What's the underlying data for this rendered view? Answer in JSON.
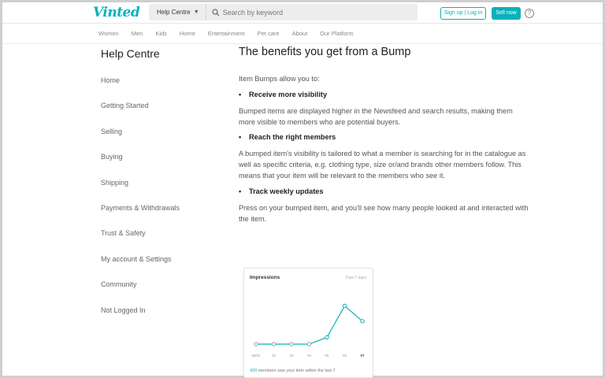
{
  "header": {
    "logo": "Vinted",
    "category_select": "Help Centre",
    "search_placeholder": "Search by keyword",
    "login_label": "Sign up | Log in",
    "sell_label": "Sell now",
    "help_glyph": "?"
  },
  "nav": {
    "categories": [
      "Women",
      "Men",
      "Kids",
      "Home",
      "Entertainment",
      "Pet care",
      "About",
      "Our Platform"
    ]
  },
  "sidebar": {
    "title": "Help Centre",
    "items": [
      "Home",
      "Getting Started",
      "Selling",
      "Buying",
      "Shipping",
      "Payments & Withdrawals",
      "Trust & Safety",
      "My account & Settings",
      "Community",
      "Not Logged In"
    ]
  },
  "article": {
    "title": "The benefits you get from a Bump",
    "intro": "Item Bumps allow you to:",
    "bullet1": "Receive more visibility",
    "para1": "Bumped items are displayed higher in the Newsfeed and search results, making them more visible to members who are potential buyers.",
    "bullet2": "Reach the right members",
    "para2": "A bumped item's visibility is tailored to what a member is searching for in the catalogue as well as specific criteria, e.g. clothing type, size or/and brands other members follow. This means that your item will be relevant to the members who see it.",
    "bullet3": "Track weekly updates",
    "para3": "Press on your bumped item, and you'll see how many people looked at and interacted with the item."
  },
  "impressions_card": {
    "title": "Impressions",
    "period": "Past 7 days",
    "footer_number": "420",
    "footer_text": " members saw your item within the last 7"
  },
  "chart_data": {
    "type": "line",
    "title": "Impressions",
    "categories": [
      "08/01",
      "02",
      "03",
      "04",
      "05",
      "06",
      "07"
    ],
    "values": [
      0,
      0,
      0,
      0,
      8,
      45,
      27
    ],
    "ylim": [
      0,
      50
    ],
    "grid": false,
    "color": "#09b1ba"
  },
  "colors": {
    "brand": "#09b1ba"
  }
}
